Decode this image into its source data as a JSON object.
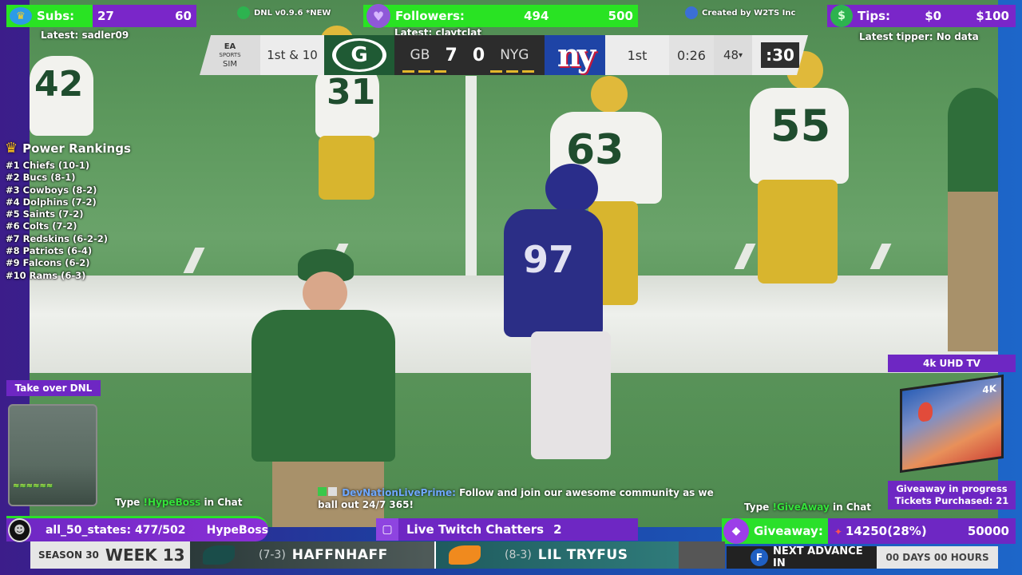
{
  "stream": {
    "subs": {
      "label": "Subs:",
      "count": "27",
      "goal": "60",
      "latest": "Latest: sadler09"
    },
    "version": "DNL v0.9.6 *NEW",
    "followers": {
      "label": "Followers:",
      "count": "494",
      "goal": "500",
      "latest": "Latest: claytclat"
    },
    "credit": "Created by W2TS Inc",
    "tips": {
      "label": "Tips:",
      "amount": "$0",
      "goal": "$100",
      "latest": "Latest tipper: No data"
    }
  },
  "scoreboard": {
    "ea_top": "EA",
    "ea_mid": "SPORTS",
    "ea_bottom": "SIM",
    "down": "1st & 10",
    "home_logo": "G",
    "home_abbr": "GB",
    "home_score": "7",
    "away_score": "0",
    "away_abbr": "NYG",
    "away_logo": "ny",
    "quarter": "1st",
    "clock": "0:26",
    "distance": "48",
    "play_clock": ":30"
  },
  "players": {
    "n1": "42",
    "n2": "31",
    "n3": "63",
    "n4": "55",
    "n5": "97"
  },
  "rankings": {
    "title": "Power Rankings",
    "items": [
      "#1 Chiefs (10-1)",
      "#2 Bucs (8-1)",
      "#3 Cowboys (8-2)",
      "#4 Dolphins (7-2)",
      "#5 Saints (7-2)",
      "#6 Colts (7-2)",
      "#7 Redskins (6-2-2)",
      "#8 Patriots (6-4)",
      "#9 Falcons (6-2)",
      "#10 Rams (6-3)"
    ]
  },
  "takeover": {
    "label": "Take over DNL"
  },
  "prize": {
    "label": "4k UHD TV",
    "tv_badge": "4K",
    "status": "Giveaway in progress",
    "tickets": "Tickets Purchased: 21"
  },
  "chat_left": {
    "type": "Type",
    "cmd": "!HypeBoss",
    "suffix": "in Chat"
  },
  "chat_right": {
    "type": "Type",
    "cmd": "!GiveAway",
    "suffix": "in Chat"
  },
  "follow_message": {
    "user": "DevNationLivePrime:",
    "text": "Follow and join our awesome community as we ball out 24/7 365!"
  },
  "hype": {
    "progress": "all_50_states: 477/502",
    "label": "HypeBoss"
  },
  "twitch": {
    "label": "Live Twitch Chatters",
    "count": "2"
  },
  "giveaway": {
    "label": "Giveaway:",
    "tickets": "14250(28%)",
    "goal": "50000"
  },
  "ticker": {
    "season": "SEASON 30",
    "week": "WEEK 13",
    "team1": {
      "record": "(7-3)",
      "name": "HAFFNHAFF"
    },
    "team2": {
      "record": "(8-3)",
      "name": "LIL TRYFUS"
    }
  },
  "advance": {
    "label": "NEXT ADVANCE IN",
    "value": "00 DAYS 00 HOURS"
  },
  "colors": {
    "accent_purple": "#6e27c3",
    "accent_green": "#29e323"
  }
}
